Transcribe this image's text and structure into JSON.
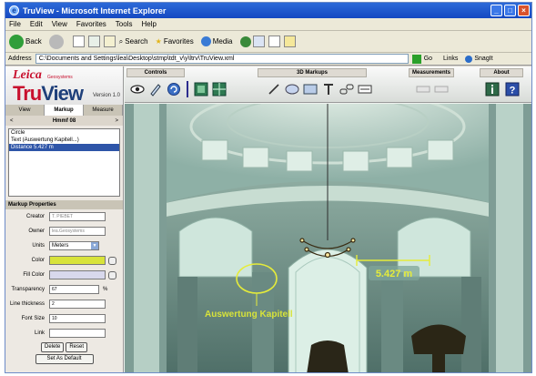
{
  "window": {
    "title": "TruView - Microsoft Internet Explorer",
    "menu": [
      "File",
      "Edit",
      "View",
      "Favorites",
      "Tools",
      "Help"
    ],
    "toolbar": {
      "back": "Back",
      "search": "Search",
      "favorites": "Favorites",
      "media": "Media"
    },
    "address": {
      "label": "Address",
      "url": "C:\\Documents and Settings\\lea\\Desktop\\stmp\\tdt_v\\y\\ltrv\\TruView.xml",
      "go": "Go",
      "links": "Links",
      "snagit": "SnagIt"
    }
  },
  "app": {
    "logo": {
      "brand": "Leica",
      "sub": "Geosystems",
      "product_a": "Tru",
      "product_b": "View",
      "version": "Version 1.0"
    },
    "tabs": [
      "View",
      "Markup",
      "Measure"
    ],
    "active_tab": "Markup",
    "nav": {
      "prev": "<",
      "label": "Hmmf 08",
      "next": ">"
    },
    "markup_list": [
      {
        "label": "Circle",
        "selected": false
      },
      {
        "label": "Text (Auswertung Kapitell...)",
        "selected": false
      },
      {
        "label": "Distance 5.427 m",
        "selected": true
      }
    ],
    "properties": {
      "title": "Markup Properties",
      "creator_label": "Creator",
      "creator": "T. PIEBET",
      "owner_label": "Owner",
      "owner": "lea.Geosystems",
      "units_label": "Units",
      "units": "Meters",
      "color_label": "Color",
      "color_hex": "#d8e33a",
      "fill_label": "Fill Color",
      "fill_hex": "#d8d8ec",
      "transparency_label": "Transparency",
      "transparency": "67",
      "transparency_unit": "%",
      "line_label": "Line thickness",
      "line": "2",
      "font_label": "Font Size",
      "font": "10",
      "link_label": "Link",
      "link": "",
      "delete_btn": "Delete",
      "reset_btn": "Reset",
      "default_btn": "Set As Default"
    },
    "groups": {
      "controls": "Controls",
      "markups": "3D Markups",
      "measurements": "Measurements",
      "about": "About"
    },
    "overlay": {
      "distance": "5.427 m",
      "annotation": "Auswertung Kapitell"
    }
  }
}
